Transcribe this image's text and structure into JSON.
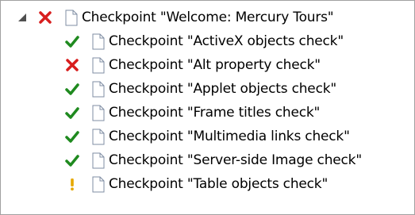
{
  "tree": {
    "root": {
      "label": "Checkpoint \"Welcome: Mercury Tours\"",
      "status": "fail",
      "expanded": true
    },
    "children": [
      {
        "label": "Checkpoint \"ActiveX objects check\"",
        "status": "pass"
      },
      {
        "label": "Checkpoint \"Alt property check\"",
        "status": "fail"
      },
      {
        "label": "Checkpoint \"Applet objects check\"",
        "status": "pass"
      },
      {
        "label": "Checkpoint \"Frame titles check\"",
        "status": "pass"
      },
      {
        "label": "Checkpoint \"Multimedia links check\"",
        "status": "pass"
      },
      {
        "label": "Checkpoint \"Server-side Image check\"",
        "status": "pass"
      },
      {
        "label": "Checkpoint \"Table objects check\"",
        "status": "warning"
      }
    ]
  },
  "colors": {
    "pass": "#1f8a1f",
    "fail": "#d81e1e",
    "warning": "#e6a800",
    "doc_border": "#7f8da3",
    "doc_fill": "#ffffff"
  },
  "icons": {
    "expander": "collapse-triangle-icon",
    "pass": "check-icon",
    "fail": "x-icon",
    "warning": "exclamation-icon",
    "node": "document-icon"
  }
}
